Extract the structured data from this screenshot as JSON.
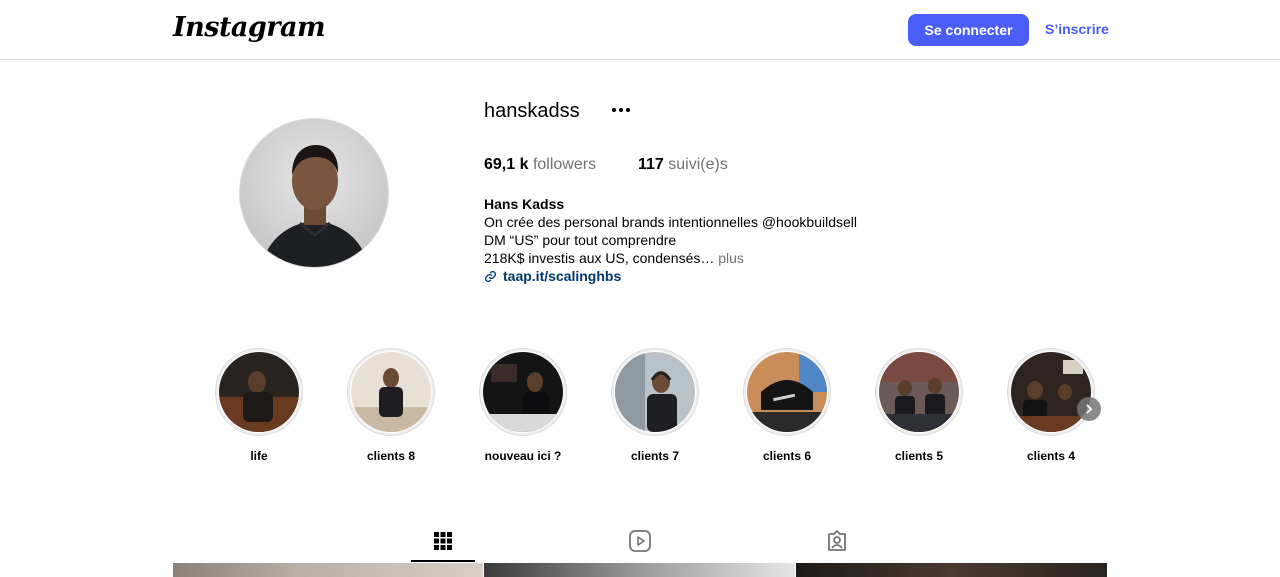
{
  "header": {
    "logo": "Instagram",
    "login_label": "Se connecter",
    "signup_label": "S’inscrire"
  },
  "profile": {
    "username": "hanskadss",
    "followers_count": "69,1 k",
    "followers_label": "followers",
    "following_count": "117",
    "following_label": "suivi(e)s",
    "full_name": "Hans Kadss",
    "bio_lines": [
      "On crée des personal brands intentionnelles @hookbuildsell",
      "DM “US” pour tout comprendre",
      "218K$ investis aux US, condensés…"
    ],
    "bio_more": "plus",
    "link": "taap.it/scalinghbs"
  },
  "highlights": [
    {
      "label": "life"
    },
    {
      "label": "clients 8"
    },
    {
      "label": "nouveau ici ?"
    },
    {
      "label": "clients 7"
    },
    {
      "label": "clients 6"
    },
    {
      "label": "clients 5"
    },
    {
      "label": "clients 4"
    }
  ],
  "tabs": [
    {
      "icon": "grid-icon",
      "active": true
    },
    {
      "icon": "reels-icon",
      "active": false
    },
    {
      "icon": "tagged-icon",
      "active": false
    }
  ],
  "colors": {
    "accent": "#4a5df9",
    "link": "#00376b",
    "muted": "#737373",
    "border": "#dbdbdb"
  }
}
